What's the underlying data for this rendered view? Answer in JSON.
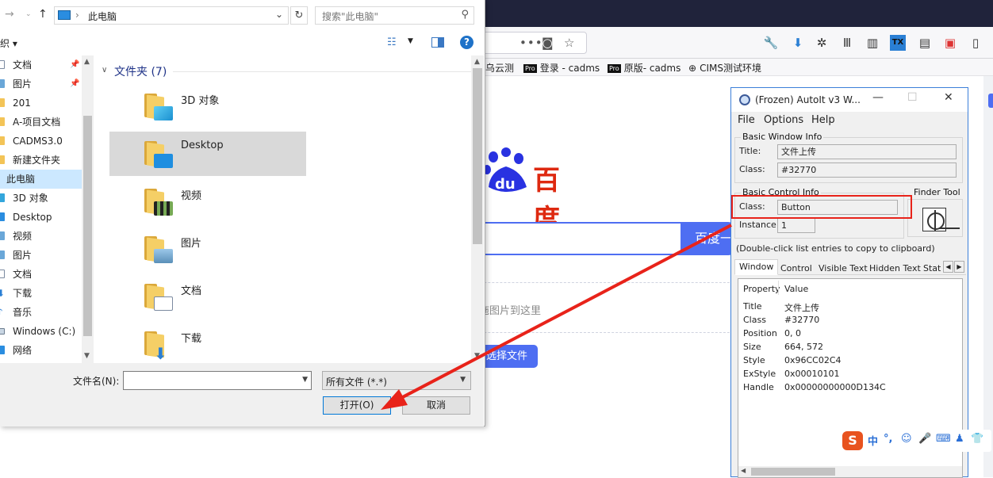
{
  "file_dialog": {
    "address": "此电脑",
    "search_placeholder": "搜索\"此电脑\"",
    "organize_label": "织 ▾",
    "nav_items": [
      {
        "label": "文档",
        "icon": "document-icon"
      },
      {
        "label": "图片",
        "icon": "picture-icon"
      },
      {
        "label": "201",
        "icon": "folder-icon"
      },
      {
        "label": "A-项目文档",
        "icon": "folder-icon"
      },
      {
        "label": "CADMS3.0",
        "icon": "folder-icon"
      },
      {
        "label": "新建文件夹",
        "icon": "folder-icon"
      },
      {
        "label": "此电脑",
        "icon": "computer-icon"
      },
      {
        "label": "3D 对象",
        "icon": "cube-icon"
      },
      {
        "label": "Desktop",
        "icon": "desktop-icon"
      },
      {
        "label": "视频",
        "icon": "video-icon"
      },
      {
        "label": "图片",
        "icon": "picture-icon"
      },
      {
        "label": "文档",
        "icon": "document-icon"
      },
      {
        "label": "下载",
        "icon": "download-icon"
      },
      {
        "label": "音乐",
        "icon": "music-icon"
      },
      {
        "label": "Windows (C:)",
        "icon": "drive-icon"
      },
      {
        "label": "网络",
        "icon": "network-icon"
      }
    ],
    "group_header": "文件夹 (7)",
    "items": [
      {
        "label": "3D 对象"
      },
      {
        "label": "Desktop"
      },
      {
        "label": "视频"
      },
      {
        "label": "图片"
      },
      {
        "label": "文档"
      },
      {
        "label": "下载"
      }
    ],
    "filename_label": "文件名(N):",
    "filename_value": "",
    "filetype_value": "所有文件 (*.*)",
    "open_label": "打开(O)",
    "cancel_label": "取消"
  },
  "browser": {
    "bookmarks": [
      {
        "label": "乌云测",
        "pro": false
      },
      {
        "label": "登录 - cadms",
        "pro": true
      },
      {
        "label": "原版- cadms",
        "pro": true
      },
      {
        "label": "CIMS测试环境",
        "pro": false
      }
    ],
    "baidu_logo_text": "百度",
    "baidu_button": "百度一",
    "drop_text": "拖图片到这里",
    "choose_file": "选择文件"
  },
  "autoit": {
    "title": "(Frozen) AutoIt v3 W...",
    "menu": [
      "File",
      "Options",
      "Help"
    ],
    "basic_window_info": "Basic Window Info",
    "title_label": "Title:",
    "title_value": "文件上传",
    "class_label": "Class:",
    "class_value": "#32770",
    "basic_control_info": "Basic Control Info",
    "finder_tool": "Finder Tool",
    "control_class_label": "Class:",
    "control_class_value": "Button",
    "instance_label": "Instance:",
    "instance_value": "1",
    "clipboard_note": "(Double-click list entries to copy to clipboard)",
    "tabs": [
      "Window",
      "Control",
      "Visible Text",
      "Hidden Text",
      "Stat"
    ],
    "list_header": {
      "property": "Property",
      "value": "Value"
    },
    "properties": [
      {
        "property": "Title",
        "value": "文件上传"
      },
      {
        "property": "Class",
        "value": "#32770"
      },
      {
        "property": "Position",
        "value": "0, 0"
      },
      {
        "property": "Size",
        "value": "664, 572"
      },
      {
        "property": "Style",
        "value": "0x96CC02C4"
      },
      {
        "property": "ExStyle",
        "value": "0x00010101"
      },
      {
        "property": "Handle",
        "value": "0x00000000000D134C"
      }
    ]
  },
  "sogou": {
    "lang": "中"
  },
  "colors": {
    "annotation": "#e8231a",
    "baidu_blue": "#4e6ef2",
    "selection": "#d9d9d9"
  }
}
